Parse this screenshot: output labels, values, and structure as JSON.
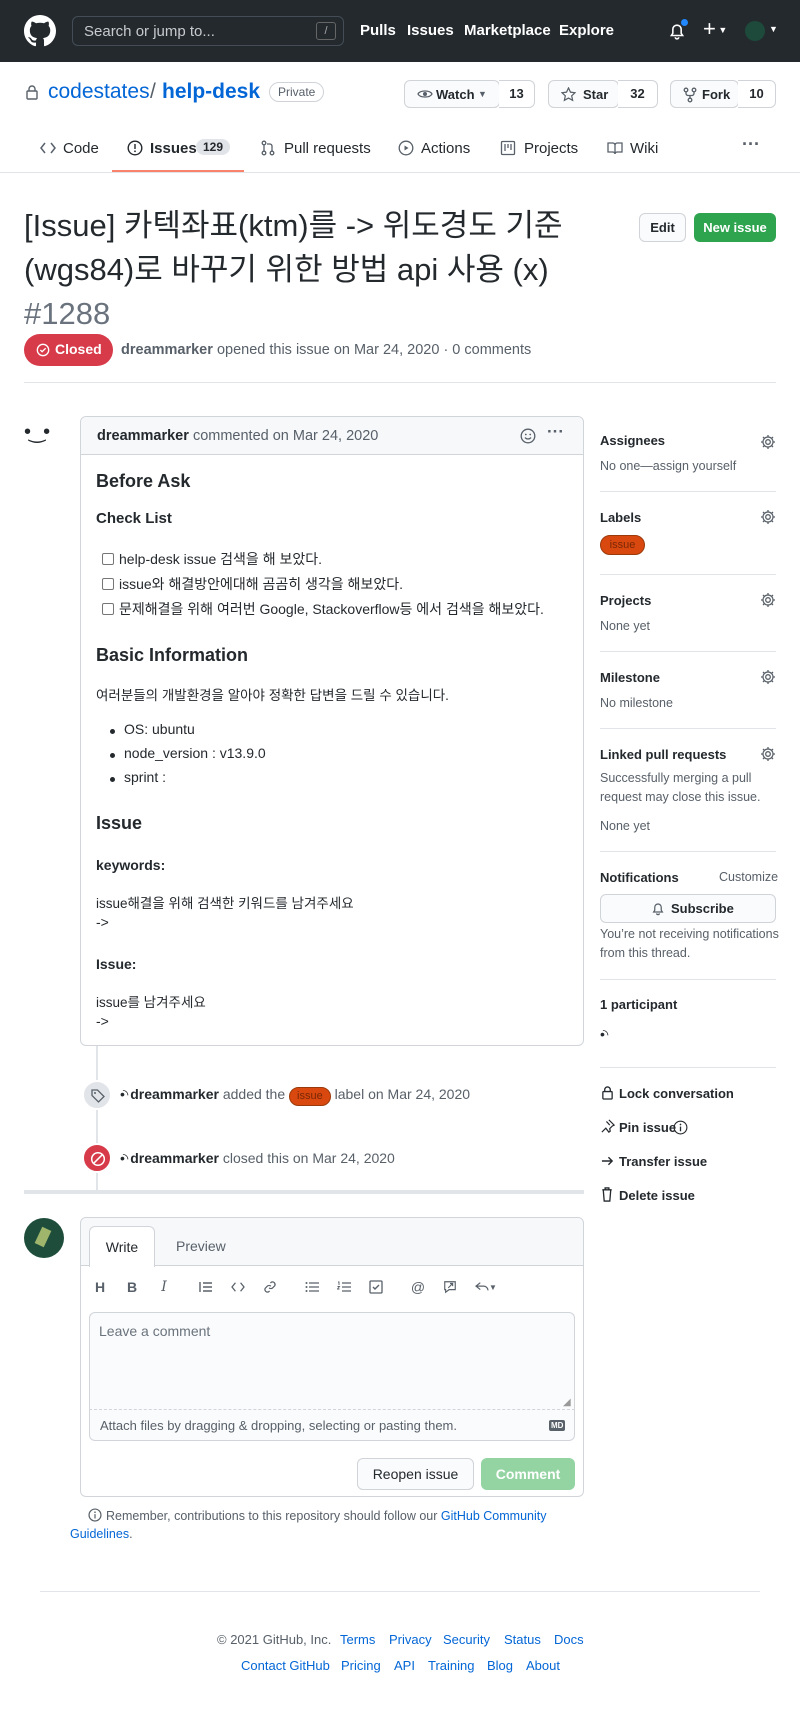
{
  "header": {
    "search_placeholder": "Search or jump to...",
    "slash": "/",
    "nav": [
      "Pulls",
      "Issues",
      "Marketplace",
      "Explore"
    ]
  },
  "repo": {
    "owner": "codestates",
    "sep": "/",
    "name": "help-desk",
    "visibility": "Private",
    "watch_label": "Watch",
    "watch_count": "13",
    "star_label": "Star",
    "star_count": "32",
    "fork_label": "Fork",
    "fork_count": "10"
  },
  "tabs": {
    "code": "Code",
    "issues": "Issues",
    "issues_count": "129",
    "pulls": "Pull requests",
    "actions": "Actions",
    "projects": "Projects",
    "wiki": "Wiki"
  },
  "issue": {
    "title_line1": "[Issue] 카텍좌표(ktm)를 -> 위도경도 기준",
    "title_line2": "(wgs84)로 바꾸기 위한 방법 api 사용 (x)",
    "number": "#1288",
    "state": "Closed",
    "author": "dreammarker",
    "opened_text": "opened this issue on Mar 24, 2020 · 0 comments",
    "edit_label": "Edit",
    "new_issue_label": "New issue"
  },
  "comment": {
    "author": "dreammarker",
    "meta": "commented on Mar 24, 2020",
    "h_before": "Before Ask",
    "h_checklist": "Check List",
    "checks": [
      "help-desk issue 검색을 해 보았다.",
      "issue와 해결방안에대해 곰곰히 생각을 해보았다.",
      "문제해결을 위해 여러번 Google, Stackoverflow등 에서 검색을 해보았다."
    ],
    "h_basic": "Basic Information",
    "basic_text": "여러분들의 개발환경을 알아야 정확한 답변을 드릴 수 있습니다.",
    "env": [
      "OS: ubuntu",
      "node_version : v13.9.0",
      "sprint :"
    ],
    "h_issue": "Issue",
    "h_keywords": "keywords:",
    "kw_text": "issue해결을 위해 검색한 키워드를 남겨주세요",
    "kw_arrow": "->",
    "h_issue2": "Issue:",
    "issue_text": "issue를 남겨주세요",
    "issue_arrow": "->"
  },
  "timeline": {
    "labeled_author": "dreammarker",
    "labeled_pre": "added the",
    "label": "issue",
    "labeled_post": "label on Mar 24, 2020",
    "closed_author": "dreammarker",
    "closed_text": "closed this on Mar 24, 2020"
  },
  "editor": {
    "write_tab": "Write",
    "preview_tab": "Preview",
    "placeholder": "Leave a comment",
    "attach": "Attach files by dragging & dropping, selecting or pasting them.",
    "md": "MD",
    "reopen_label": "Reopen issue",
    "comment_label": "Comment",
    "guideline_pre": "Remember, contributions to this repository should follow our",
    "guideline_link1": "GitHub Community",
    "guideline_link2": "Guidelines",
    "guideline_dot": "."
  },
  "sidebar": {
    "assignees_h": "Assignees",
    "assignees_v": "No one—assign yourself",
    "labels_h": "Labels",
    "label_v": "issue",
    "projects_h": "Projects",
    "projects_v": "None yet",
    "milestone_h": "Milestone",
    "milestone_v": "No milestone",
    "linked_h": "Linked pull requests",
    "linked_v1": "Successfully merging a pull",
    "linked_v2": "request may close this issue.",
    "linked_v3": "None yet",
    "notif_h": "Notifications",
    "customize": "Customize",
    "subscribe": "Subscribe",
    "notif_v1": "You’re not receiving notifications",
    "notif_v2": "from this thread.",
    "participants_h": "1 participant",
    "lock": "Lock conversation",
    "pin": "Pin issue",
    "transfer": "Transfer issue",
    "delete": "Delete issue"
  },
  "footer": {
    "copyright": "© 2021 GitHub, Inc.",
    "row1": [
      "Terms",
      "Privacy",
      "Security",
      "Status",
      "Docs"
    ],
    "row2": [
      "Contact GitHub",
      "Pricing",
      "API",
      "Training",
      "Blog",
      "About"
    ]
  },
  "colors": {
    "closed_red": "#d73a49",
    "green": "#2ea44f",
    "label_orange": "#d9480f",
    "link": "#0366d6"
  }
}
